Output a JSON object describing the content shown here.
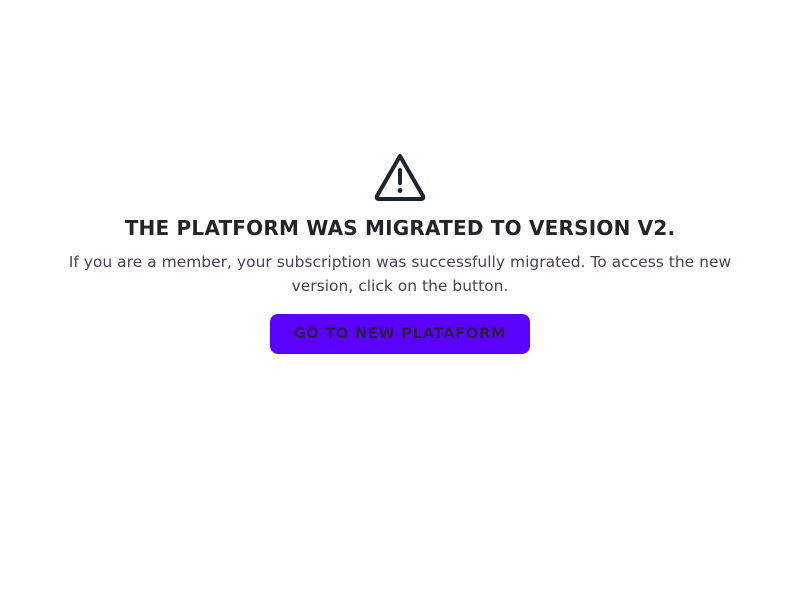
{
  "notice": {
    "icon": "warning-triangle-icon",
    "title": "THE PLATFORM WAS MIGRATED TO VERSION V2.",
    "message": "If you are a member, your subscription was successfully migrated. To access the new version, click on the button.",
    "button_label": "GO TO NEW PLATAFORM"
  },
  "colors": {
    "background": "#ffffff",
    "title": "#23232b",
    "message": "#4a3f5c",
    "button_background": "#5c00ff",
    "button_text": "#2a2140",
    "icon": "#1c2430"
  }
}
